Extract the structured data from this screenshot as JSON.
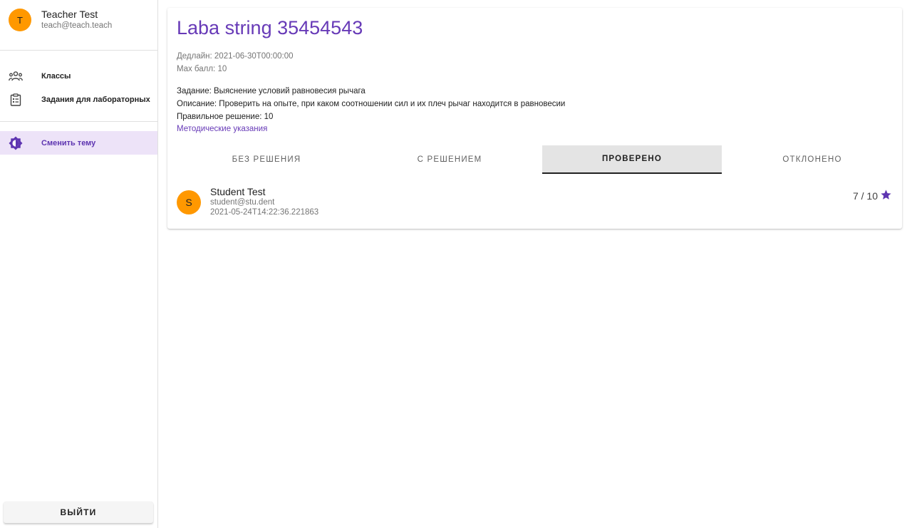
{
  "user": {
    "avatar_letter": "T",
    "name": "Teacher Test",
    "email": "teach@teach.teach"
  },
  "nav": {
    "items": [
      {
        "label": "Классы",
        "icon": "group-icon"
      },
      {
        "label": "Задания для лабораторных",
        "icon": "clipboard-icon"
      }
    ],
    "theme": {
      "label": "Сменить тему",
      "icon": "theme-icon"
    },
    "logout_label": "ВЫЙТИ"
  },
  "assignment": {
    "title": "Laba string 35454543",
    "deadline": "Дедлайн: 2021-06-30T00:00:00",
    "max_score": "Max балл: 10",
    "task": "Задание: Выяснение условий равновесия рычага",
    "description": "Описание: Проверить на опыте, при каком соотношении сил и их плеч рычаг находится в равновесии",
    "correct_answer": "Правильное решение: 10",
    "guidelines_link": "Методические указания"
  },
  "tabs": [
    {
      "label": "БЕЗ РЕШЕНИЯ",
      "active": false
    },
    {
      "label": "С РЕШЕНИЕМ",
      "active": false
    },
    {
      "label": "ПРОВЕРЕНО",
      "active": true
    },
    {
      "label": "ОТКЛОНЕНО",
      "active": false
    }
  ],
  "submissions": [
    {
      "avatar_letter": "S",
      "name": "Student Test",
      "email": "student@stu.dent",
      "timestamp": "2021-05-24T14:22:36.221863",
      "score": "7 / 10",
      "score_icon": "star-icon"
    }
  ],
  "colors": {
    "accent": "#673ab7",
    "avatar": "#ff9800",
    "active_nav_bg": "#ede3f8",
    "active_tab_bg": "#e4e4e4"
  }
}
